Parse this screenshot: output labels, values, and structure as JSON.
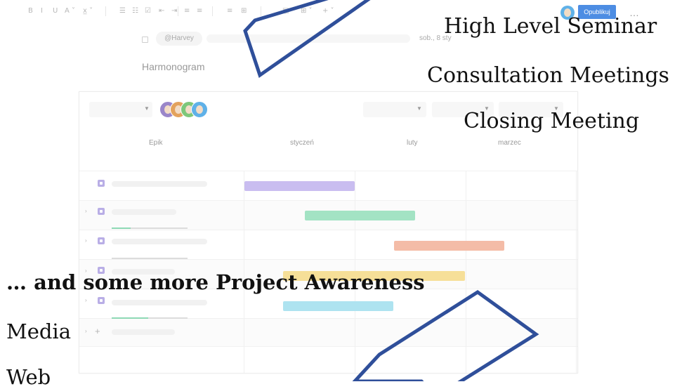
{
  "toolbar": {
    "buttons": [
      {
        "name": "bold-button",
        "label": "B"
      },
      {
        "name": "italic-button",
        "label": "I"
      },
      {
        "name": "underline-button",
        "label": "U"
      },
      {
        "name": "text-color-button",
        "label": "A ˅"
      },
      {
        "name": "clear-format-button",
        "label": "x̲ ˅"
      },
      {
        "name": "bullet-list-button",
        "label": "☰"
      },
      {
        "name": "numbered-list-button",
        "label": "☷"
      },
      {
        "name": "checklist-button",
        "label": "☑"
      },
      {
        "name": "indent-button",
        "label": "⇤"
      },
      {
        "name": "outdent-button",
        "label": "⇥"
      },
      {
        "name": "align-left-button",
        "label": "≡"
      },
      {
        "name": "align-center-button",
        "label": "≡"
      },
      {
        "name": "align-right-button",
        "label": "≡"
      },
      {
        "name": "embed-button",
        "label": "⊞"
      },
      {
        "name": "image-button",
        "label": "▣"
      },
      {
        "name": "table-button",
        "label": "⊞ ˅"
      },
      {
        "name": "insert-button",
        "label": "+ ˅"
      }
    ],
    "publish_label": "Opublikuj",
    "more_label": "…"
  },
  "meta": {
    "mention": "@Harvey",
    "date": "sob., 8 sty"
  },
  "page_title": "Harmonogram",
  "timeline": {
    "headers": [
      "Epik",
      "styczeń",
      "luty",
      "marzec"
    ],
    "avatar_colors": [
      "#9a86c9",
      "#e3a25d",
      "#7ec77a",
      "#5fb1e8"
    ],
    "bars": [
      {
        "color": "#c9bdf0"
      },
      {
        "color": "#a3e3c4"
      },
      {
        "color": "#f4bca7"
      },
      {
        "color": "#f6df98"
      },
      {
        "color": "#aee3f0"
      }
    ]
  },
  "slide": {
    "right_items": [
      "High Level Seminar",
      "Consultation Meetings",
      "Closing Meeting"
    ],
    "heading": "… and some more Project Awareness",
    "left_items": [
      "Media",
      "Web"
    ]
  }
}
